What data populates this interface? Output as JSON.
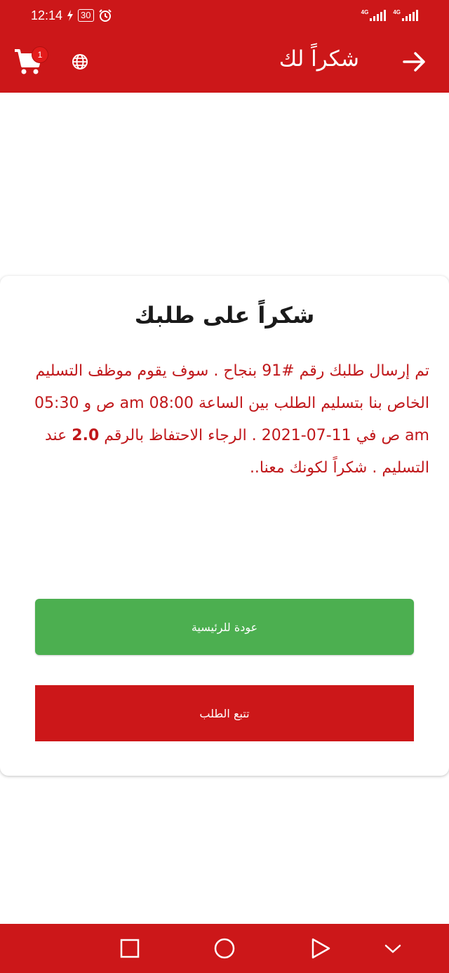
{
  "status_bar": {
    "time": "12:14",
    "battery": "30",
    "network_1": "4G",
    "network_2": "4G",
    "icons": [
      "charging-icon",
      "battery-icon",
      "alarm-icon",
      "signal-icon",
      "signal-icon"
    ]
  },
  "app_bar": {
    "title": "شكراً لك",
    "cart_count": "1",
    "icons": [
      "back-arrow-icon",
      "cart-icon",
      "globe-icon"
    ]
  },
  "card": {
    "title": "شكراً على طلبك",
    "message_part1": "تم إرسال طلبك رقم #91 بنجاح . سوف يقوم موظف التسليم الخاص بنا بتسليم الطلب بين الساعة 08:00 am ص و 05:30 am ص في 11-07-2021 . الرجاء الاحتفاظ بالرقم ",
    "message_bold": "2.0",
    "message_part2": " عند التسليم . شكراً لكونك معنا.."
  },
  "buttons": {
    "home_label": "عودة للرئيسية",
    "track_label": "تتبع الطلب"
  },
  "navigation": {
    "icons": [
      "square-icon",
      "circle-icon",
      "triangle-back-icon",
      "chevron-down-icon"
    ]
  },
  "colors": {
    "primary": "#cc1719",
    "success": "#4caf50",
    "message_text": "#c0181b",
    "badge": "#e31b1b"
  }
}
